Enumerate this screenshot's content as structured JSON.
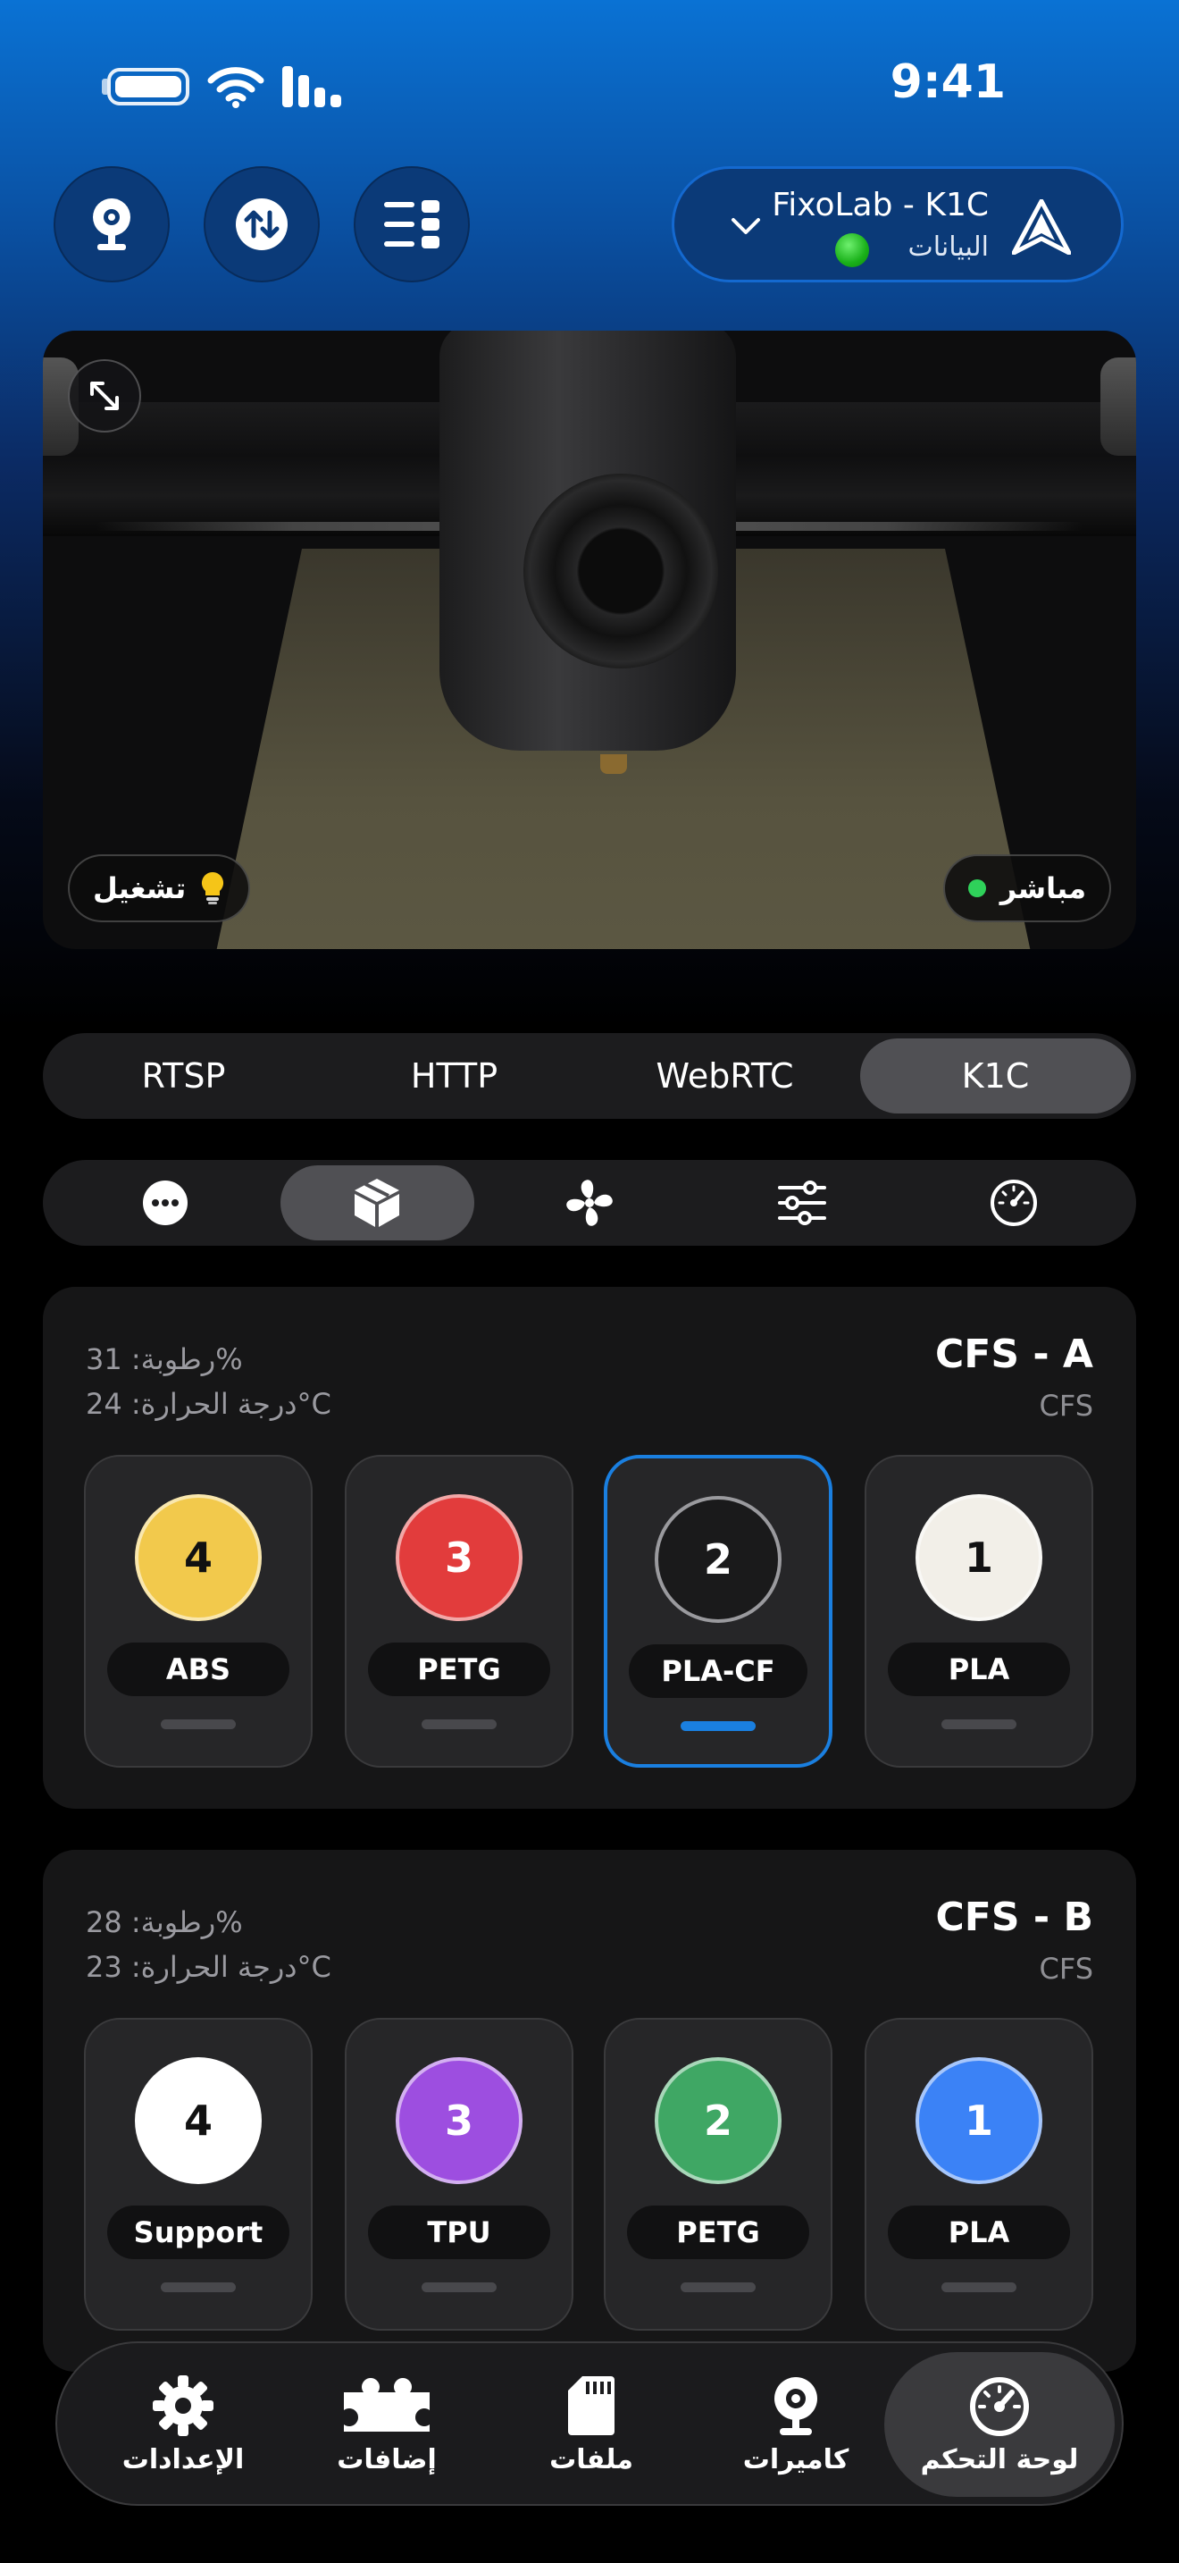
{
  "status_bar": {
    "time": "9:41"
  },
  "printer": {
    "name": "FixoLab - K1C",
    "status": "البيانات",
    "status_color": "#22c322"
  },
  "camera": {
    "light_label": "تشغيل",
    "live_label": "مباشر",
    "live_color": "#2fd15a"
  },
  "stream_tabs": [
    {
      "label": "RTSP"
    },
    {
      "label": "HTTP"
    },
    {
      "label": "WebRTC"
    },
    {
      "label": "K1C",
      "active": true
    }
  ],
  "icon_tabs": [
    {
      "icon": "more-icon"
    },
    {
      "icon": "box-icon",
      "active": true
    },
    {
      "icon": "fan-icon"
    },
    {
      "icon": "sliders-icon"
    },
    {
      "icon": "gauge-icon"
    }
  ],
  "cfs_units": [
    {
      "title": "CFS - A",
      "subtitle": "CFS",
      "humidity": "رطوبة: 31%",
      "temperature": "درجة الحرارة: 24°C",
      "slots": [
        {
          "number": "1",
          "material": "PLA",
          "color": "#f2efe8",
          "text_color": "#111"
        },
        {
          "number": "2",
          "material": "PLA-CF",
          "color": "#1a1a1b",
          "text_color": "#fff",
          "selected": true
        },
        {
          "number": "3",
          "material": "PETG",
          "color": "#e23c3c",
          "text_color": "#fff"
        },
        {
          "number": "4",
          "material": "ABS",
          "color": "#f2c94c",
          "text_color": "#111"
        }
      ]
    },
    {
      "title": "CFS - B",
      "subtitle": "CFS",
      "humidity": "رطوبة: 28%",
      "temperature": "درجة الحرارة: 23°C",
      "slots": [
        {
          "number": "1",
          "material": "PLA",
          "color": "#3b82f6",
          "text_color": "#fff"
        },
        {
          "number": "2",
          "material": "PETG",
          "color": "#3fa764",
          "text_color": "#fff"
        },
        {
          "number": "3",
          "material": "TPU",
          "color": "#9d4ee0",
          "text_color": "#fff"
        },
        {
          "number": "4",
          "material": "Support",
          "color": "#ffffff",
          "text_color": "#111"
        }
      ]
    }
  ],
  "bottom_nav": [
    {
      "label": "لوحة التحكم",
      "icon": "gauge-icon",
      "active": true
    },
    {
      "label": "كاميرات",
      "icon": "webcam-icon"
    },
    {
      "label": "ملفات",
      "icon": "sd-card-icon"
    },
    {
      "label": "إضافات",
      "icon": "puzzle-icon"
    },
    {
      "label": "الإعدادات",
      "icon": "gear-icon"
    }
  ],
  "colors": {
    "accent": "#1a7fe0",
    "header_blue": "#0a72d4",
    "card_bg": "#161617"
  }
}
